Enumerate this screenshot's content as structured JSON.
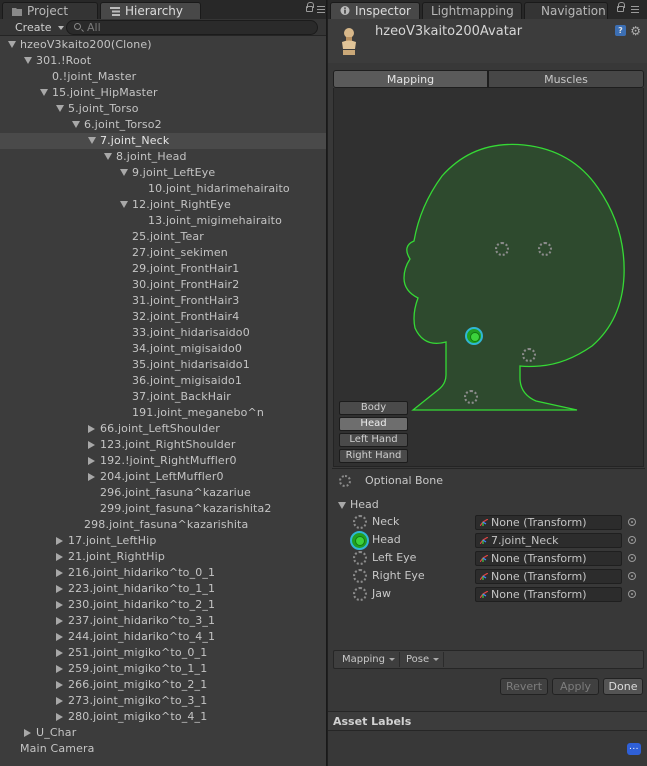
{
  "colors": {
    "accent_green": "#22a022",
    "figure_outline": "#35d935",
    "select_blue": "#2fb6d4"
  },
  "left": {
    "tabs": [
      {
        "label": "Project",
        "icon": "folder-icon"
      },
      {
        "label": "Hierarchy",
        "icon": "list-icon"
      }
    ],
    "create_label": "Create",
    "search_placeholder": "All",
    "tree": [
      {
        "label": "hzeoV3kaito200(Clone)",
        "depth": 0,
        "arrow": "open"
      },
      {
        "label": "301.!Root",
        "depth": 1,
        "arrow": "open"
      },
      {
        "label": "0.!joint_Master",
        "depth": 2,
        "arrow": "none"
      },
      {
        "label": "15.joint_HipMaster",
        "depth": 2,
        "arrow": "open"
      },
      {
        "label": "5.joint_Torso",
        "depth": 3,
        "arrow": "open"
      },
      {
        "label": "6.joint_Torso2",
        "depth": 4,
        "arrow": "open"
      },
      {
        "label": "7.joint_Neck",
        "depth": 5,
        "arrow": "open",
        "selected": true
      },
      {
        "label": "8.joint_Head",
        "depth": 6,
        "arrow": "open"
      },
      {
        "label": "9.joint_LeftEye",
        "depth": 7,
        "arrow": "open"
      },
      {
        "label": "10.joint_hidarimehairaito",
        "depth": 8,
        "arrow": "none"
      },
      {
        "label": "12.joint_RightEye",
        "depth": 7,
        "arrow": "open"
      },
      {
        "label": "13.joint_migimehairaito",
        "depth": 8,
        "arrow": "none"
      },
      {
        "label": "25.joint_Tear",
        "depth": 7,
        "arrow": "none"
      },
      {
        "label": "27.joint_sekimen",
        "depth": 7,
        "arrow": "none"
      },
      {
        "label": "29.joint_FrontHair1",
        "depth": 7,
        "arrow": "none"
      },
      {
        "label": "30.joint_FrontHair2",
        "depth": 7,
        "arrow": "none"
      },
      {
        "label": "31.joint_FrontHair3",
        "depth": 7,
        "arrow": "none"
      },
      {
        "label": "32.joint_FrontHair4",
        "depth": 7,
        "arrow": "none"
      },
      {
        "label": "33.joint_hidarisaido0",
        "depth": 7,
        "arrow": "none"
      },
      {
        "label": "34.joint_migisaido0",
        "depth": 7,
        "arrow": "none"
      },
      {
        "label": "35.joint_hidarisaido1",
        "depth": 7,
        "arrow": "none"
      },
      {
        "label": "36.joint_migisaido1",
        "depth": 7,
        "arrow": "none"
      },
      {
        "label": "37.joint_BackHair",
        "depth": 7,
        "arrow": "none"
      },
      {
        "label": "191.joint_meganebo^n",
        "depth": 7,
        "arrow": "none"
      },
      {
        "label": "66.joint_LeftShoulder",
        "depth": 5,
        "arrow": "closed"
      },
      {
        "label": "123.joint_RightShoulder",
        "depth": 5,
        "arrow": "closed"
      },
      {
        "label": "192.!joint_RightMuffler0",
        "depth": 5,
        "arrow": "closed"
      },
      {
        "label": "204.joint_LeftMuffler0",
        "depth": 5,
        "arrow": "closed"
      },
      {
        "label": "296.joint_fasuna^kazariue",
        "depth": 5,
        "arrow": "none"
      },
      {
        "label": "299.joint_fasuna^kazarishita2",
        "depth": 5,
        "arrow": "none"
      },
      {
        "label": "298.joint_fasuna^kazarishita",
        "depth": 4,
        "arrow": "none"
      },
      {
        "label": "17.joint_LeftHip",
        "depth": 3,
        "arrow": "closed"
      },
      {
        "label": "21.joint_RightHip",
        "depth": 3,
        "arrow": "closed"
      },
      {
        "label": "216.joint_hidariko^to_0_1",
        "depth": 3,
        "arrow": "closed"
      },
      {
        "label": "223.joint_hidariko^to_1_1",
        "depth": 3,
        "arrow": "closed"
      },
      {
        "label": "230.joint_hidariko^to_2_1",
        "depth": 3,
        "arrow": "closed"
      },
      {
        "label": "237.joint_hidariko^to_3_1",
        "depth": 3,
        "arrow": "closed"
      },
      {
        "label": "244.joint_hidariko^to_4_1",
        "depth": 3,
        "arrow": "closed"
      },
      {
        "label": "251.joint_migiko^to_0_1",
        "depth": 3,
        "arrow": "closed"
      },
      {
        "label": "259.joint_migiko^to_1_1",
        "depth": 3,
        "arrow": "closed"
      },
      {
        "label": "266.joint_migiko^to_2_1",
        "depth": 3,
        "arrow": "closed"
      },
      {
        "label": "273.joint_migiko^to_3_1",
        "depth": 3,
        "arrow": "closed"
      },
      {
        "label": "280.joint_migiko^to_4_1",
        "depth": 3,
        "arrow": "closed"
      },
      {
        "label": "U_Char",
        "depth": 1,
        "arrow": "closed"
      },
      {
        "label": "Main Camera",
        "depth": 0,
        "arrow": "none"
      }
    ]
  },
  "right": {
    "tabs": [
      {
        "label": "Inspector",
        "icon": "info-icon"
      },
      {
        "label": "Lightmapping"
      },
      {
        "label": "Navigation"
      }
    ],
    "title": "hzeoV3kaito200Avatar",
    "help_glyph": "?",
    "segments": {
      "mapping": "Mapping",
      "muscles": "Muscles"
    },
    "body_parts": [
      {
        "label": "Body"
      },
      {
        "label": "Head",
        "active": true
      },
      {
        "label": "Left Hand"
      },
      {
        "label": "Right Hand"
      }
    ],
    "optional_bone_label": "Optional Bone",
    "group_label": "Head",
    "bones": [
      {
        "label": "Neck",
        "value": "None (Transform)",
        "mapped": false
      },
      {
        "label": "Head",
        "value": "7.joint_Neck",
        "mapped": true
      },
      {
        "label": "Left Eye",
        "value": "None (Transform)",
        "mapped": false
      },
      {
        "label": "Right Eye",
        "value": "None (Transform)",
        "mapped": false
      },
      {
        "label": "Jaw",
        "value": "None (Transform)",
        "mapped": false
      }
    ],
    "bottom_buttons": {
      "mapping": "Mapping",
      "pose": "Pose"
    },
    "actions": {
      "revert": "Revert",
      "apply": "Apply",
      "done": "Done"
    },
    "asset_labels": "Asset Labels",
    "dots_glyph": "..."
  }
}
